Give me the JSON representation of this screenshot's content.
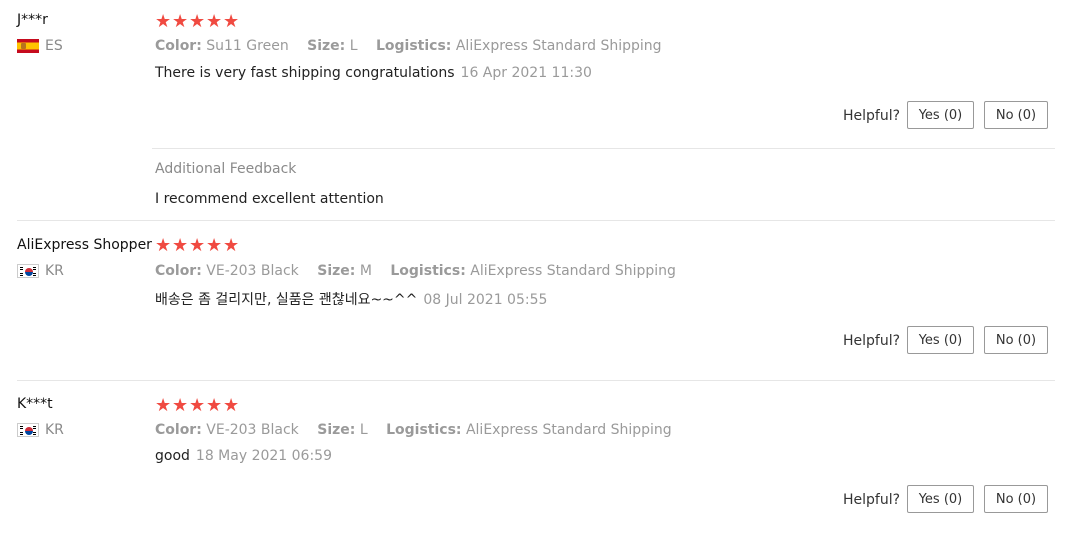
{
  "reviews": [
    {
      "username": "J***r",
      "country": "ES",
      "rating": 5,
      "color_label": "Color:",
      "color": "Su11 Green",
      "size_label": "Size:",
      "size": "L",
      "logistics_label": "Logistics:",
      "logistics": "AliExpress Standard Shipping",
      "text": "There is very fast shipping congratulations",
      "date": "16 Apr 2021 11:30",
      "helpful_label": "Helpful?",
      "yes_label": "Yes (0)",
      "no_label": "No (0)",
      "additional_title": "Additional Feedback",
      "additional_text": "I recommend excellent attention"
    },
    {
      "username": "AliExpress Shopper",
      "country": "KR",
      "rating": 5,
      "color_label": "Color:",
      "color": "VE-203 Black",
      "size_label": "Size:",
      "size": "M",
      "logistics_label": "Logistics:",
      "logistics": "AliExpress Standard Shipping",
      "text": "배송은 좀 걸리지만, 실품은 괜찮네요~~^^",
      "date": "08 Jul 2021 05:55",
      "helpful_label": "Helpful?",
      "yes_label": "Yes (0)",
      "no_label": "No (0)"
    },
    {
      "username": "K***t",
      "country": "KR",
      "rating": 5,
      "color_label": "Color:",
      "color": "VE-203 Black",
      "size_label": "Size:",
      "size": "L",
      "logistics_label": "Logistics:",
      "logistics": "AliExpress Standard Shipping",
      "text": "good",
      "date": "18 May 2021 06:59",
      "helpful_label": "Helpful?",
      "yes_label": "Yes (0)",
      "no_label": "No (0)"
    }
  ],
  "colors": {
    "star": "#f04a41",
    "muted": "#9a9a9a",
    "divider": "#e6e6e6"
  },
  "icons": {
    "star": "star-icon",
    "flag_es": "spain-flag-icon",
    "flag_kr": "korea-flag-icon"
  }
}
